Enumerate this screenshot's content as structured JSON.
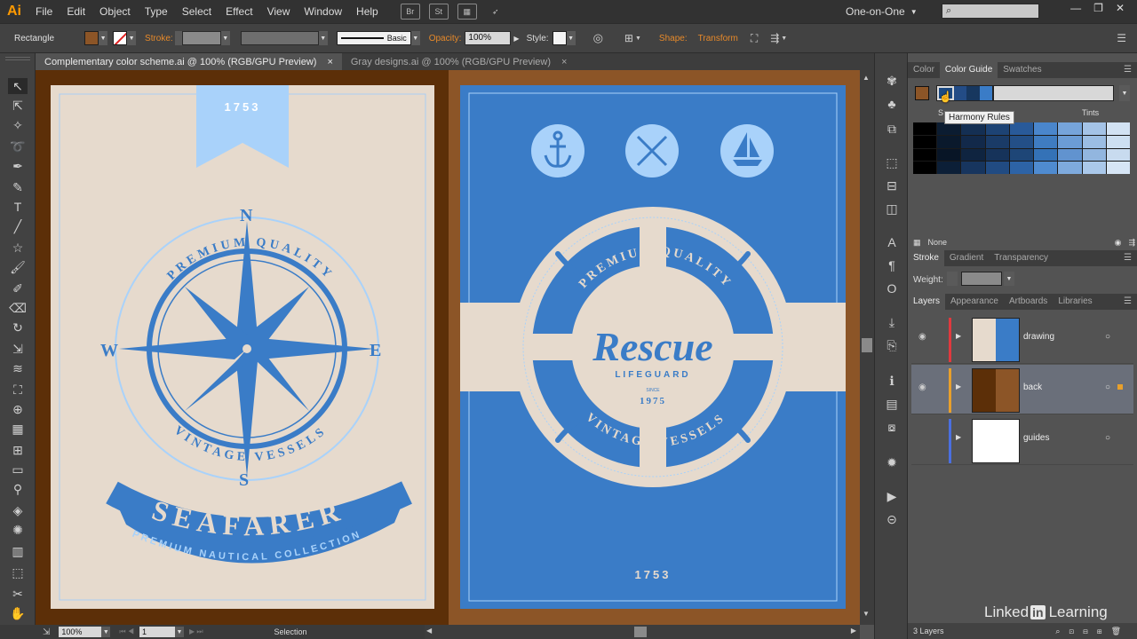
{
  "app": {
    "logo": "Ai"
  },
  "menu": [
    "File",
    "Edit",
    "Object",
    "Type",
    "Select",
    "Effect",
    "View",
    "Window",
    "Help"
  ],
  "menubar_icons": [
    "Br",
    "St"
  ],
  "workspace": "One-on-One",
  "control": {
    "tool": "Rectangle",
    "stroke_label": "Stroke:",
    "stroke_style": "Basic",
    "opacity_label": "Opacity:",
    "opacity_value": "100%",
    "style_label": "Style:",
    "shape_label": "Shape:",
    "transform_label": "Transform",
    "fill_color": "#8c5527"
  },
  "tabs": [
    {
      "label": "Complementary color scheme.ai @ 100% (RGB/GPU Preview)",
      "close": "×"
    },
    {
      "label": "Gray designs.ai @ 100% (RGB/GPU Preview)",
      "close": "×"
    }
  ],
  "status": {
    "zoom": "100%",
    "page": "1",
    "tool": "Selection"
  },
  "artboard_left": {
    "ribbon_year": "1753",
    "north": "N",
    "south": "S",
    "west": "W",
    "east": "E",
    "arc_top": "PREMIUM QUALITY",
    "arc_bottom": "VINTAGE VESSELS",
    "banner": "SEAFARER",
    "sub": "PREMIUM NAUTICAL COLLECTION"
  },
  "artboard_right": {
    "arc_top": "PREMIUM QUALITY",
    "arc_bottom": "VINTAGE VESSELS",
    "title": "Rescue",
    "subtitle": "LIFEGUARD",
    "since": "SINCE",
    "year": "1975",
    "footer_year": "1753"
  },
  "color_panel": {
    "tabs": [
      "Color",
      "Color Guide",
      "Swatches"
    ],
    "tooltip": "Harmony Rules",
    "shades_label": "S",
    "tints_label": "Tints",
    "footer_label": "None",
    "base_color": "#8c5527"
  },
  "stroke_panel": {
    "tabs": [
      "Stroke",
      "Gradient",
      "Transparency"
    ],
    "weight_label": "Weight:"
  },
  "layers_panel": {
    "tabs": [
      "Layers",
      "Appearance",
      "Artboards",
      "Libraries"
    ],
    "layers": [
      {
        "name": "drawing",
        "color": "#e0393e"
      },
      {
        "name": "back",
        "color": "#e8a02c"
      },
      {
        "name": "guides",
        "color": "#4b6fe0"
      }
    ],
    "footer": "3 Layers"
  },
  "watermark": {
    "brand": "Linked",
    "in": "in",
    "suffix": "Learning"
  }
}
